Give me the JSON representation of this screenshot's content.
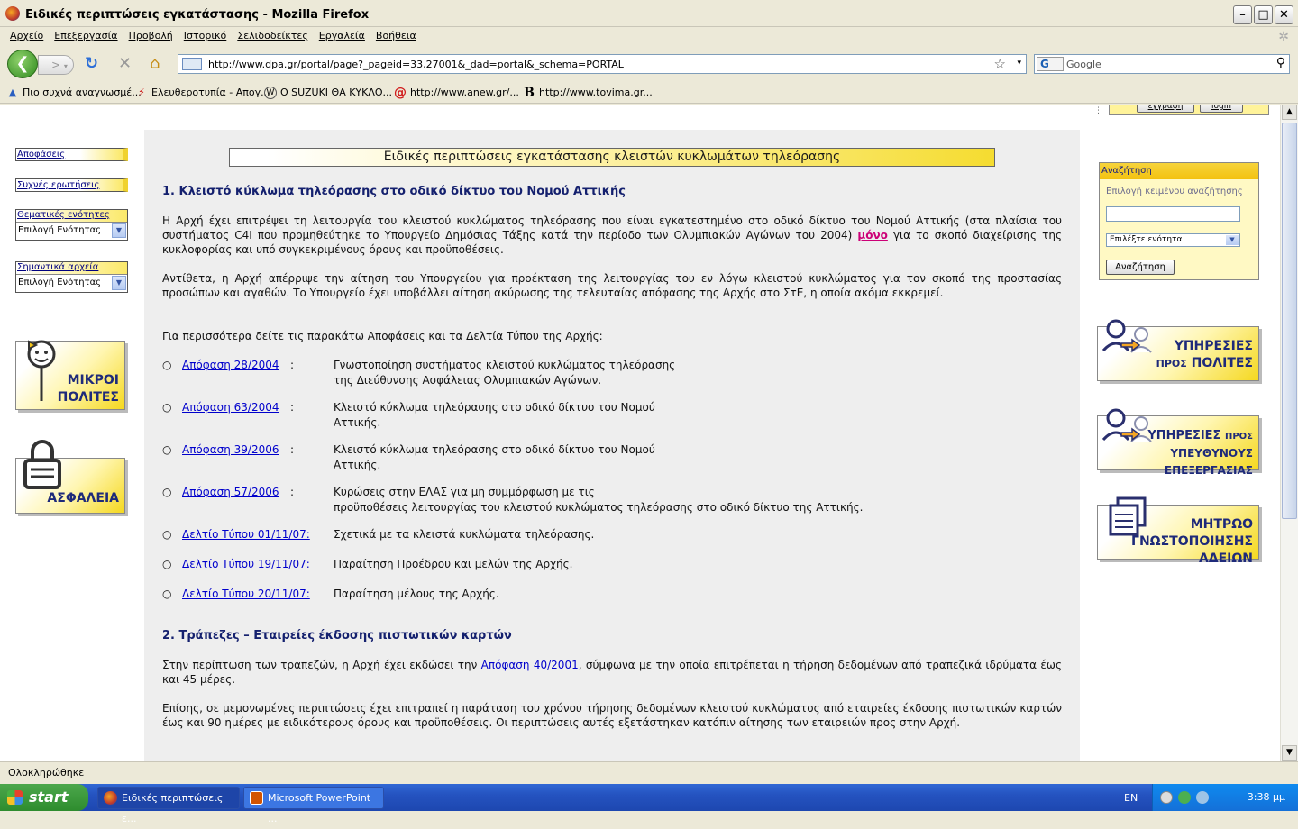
{
  "window": {
    "title": "Ειδικές περιπτώσεις εγκατάστασης - Mozilla Firefox"
  },
  "menu": [
    "Αρχείο",
    "Επεξεργασία",
    "Προβολή",
    "Ιστορικό",
    "Σελιδοδείκτες",
    "Εργαλεία",
    "Βοήθεια"
  ],
  "nav": {
    "url": "http://www.dpa.gr/portal/page?_pageid=33,27001&_dad=portal&_schema=PORTAL",
    "search_placeholder": "Google",
    "search_engine": "G"
  },
  "bookmarks": [
    {
      "icon": "person-icon",
      "label": "Πιο συχνά αναγνωσμέ..."
    },
    {
      "icon": "enet-icon",
      "label": "Ελευθεροτυπία - Απογ..."
    },
    {
      "icon": "wordpress-icon",
      "label": "Ο SUZUKI ΘΑ ΚΥΚΛΟ..."
    },
    {
      "icon": "at-icon",
      "label": "http://www.anew.gr/..."
    },
    {
      "icon": "b-icon",
      "label": "http://www.tovima.gr..."
    }
  ],
  "page": {
    "top_buttons": {
      "register": "εγγραφή",
      "login": "login"
    },
    "left": {
      "decisions": "Αποφάσεις",
      "faq": "Συχνές ερωτήσεις",
      "thematic": {
        "label": "Θεματικές ενότητες",
        "value": "Επιλογή Ενότητας"
      },
      "archives": {
        "label": "Σημαντικά αρχεία",
        "value": "Επιλογή Ενότητας"
      },
      "kids": [
        "ΜΙΚΡΟΙ",
        "ΠΟΛΙΤΕΣ"
      ],
      "security": "ΑΣΦΑΛΕΙΑ"
    },
    "title": "Ειδικές περιπτώσεις εγκατάστασης κλειστών κυκλωμάτων τηλεόρασης",
    "s1": {
      "heading": "1. Κλειστό κύκλωμα τηλεόρασης στο οδικό δίκτυο του Νομού Αττικής",
      "p1a": "Η Αρχή έχει επιτρέψει τη λειτουργία του κλειστού κυκλώματος τηλεόρασης που είναι εγκατεστημένο στο οδικό δίκτυο του Νομού Αττικής (στα πλαίσια του συστήματος C4I που προμηθεύτηκε το Υπουργείο Δημόσιας Τάξης κατά την περίοδο των Ολυμπιακών Αγώνων του 2004)",
      "p1link": "μόνο",
      "p1b": "για το σκοπό διαχείρισης της κυκλοφορίας και υπό συγκεκριμένους όρους και προϋποθέσεις.",
      "p2": "Αντίθετα, η Αρχή απέρριψε την αίτηση του Υπουργείου για προέκταση της λειτουργίας του εν λόγω κλειστού κυκλώματος για τον σκοπό της προστασίας προσώπων και αγαθών. Το Υπουργείο έχει υποβάλλει αίτηση ακύρωσης της τελευταίας απόφασης της Αρχής στο ΣτΕ, η οποία ακόμα εκκρεμεί.",
      "p3": "Για περισσότερα δείτε τις παρακάτω Αποφάσεις και τα Δελτία Τύπου της Αρχής:",
      "items": [
        {
          "link": "Απόφαση 28/2004",
          "sep": ":",
          "l1": "Γνωστοποίηση συστήματος κλειστού κυκλώματος τηλεόρασης",
          "l2": "της Διεύθυνσης Ασφάλειας Ολυμπιακών Αγώνων."
        },
        {
          "link": "Απόφαση 63/2004",
          "sep": ":",
          "l1": "Κλειστό κύκλωμα τηλεόρασης στο οδικό δίκτυο του Νομού",
          "l2": "Αττικής."
        },
        {
          "link": "Απόφαση 39/2006",
          "sep": ":",
          "l1": "Κλειστό κύκλωμα τηλεόρασης στο οδικό δίκτυο του Νομού",
          "l2": "Αττικής."
        },
        {
          "link": "Απόφαση 57/2006",
          "sep": ":",
          "l1": "Κυρώσεις στην ΕΛΑΣ για μη συμμόρφωση με τις",
          "l2": "προϋποθέσεις λειτουργίας του κλειστού κυκλώματος τηλεόρασης στο οδικό δίκτυο της Αττικής."
        },
        {
          "link": "Δελτίο Τύπου 01/11/07:",
          "sep": "",
          "l1": "Σχετικά με τα κλειστά κυκλώματα τηλεόρασης.",
          "l2": ""
        },
        {
          "link": "Δελτίο Τύπου 19/11/07:",
          "sep": "",
          "l1": "Παραίτηση Προέδρου και μελών της Αρχής.",
          "l2": ""
        },
        {
          "link": "Δελτίο Τύπου 20/11/07:",
          "sep": "",
          "l1": "Παραίτηση μέλους της Αρχής.",
          "l2": ""
        }
      ]
    },
    "s2": {
      "heading": "2. Τράπεζες – Εταιρείες έκδοσης πιστωτικών καρτών",
      "p1a": "Στην περίπτωση των τραπεζών, η Αρχή έχει εκδώσει την",
      "p1link": "Απόφαση 40/2001",
      "p1b": ", σύμφωνα με την οποία επιτρέπεται η τήρηση δεδομένων από τραπεζικά ιδρύματα έως και 45 μέρες.",
      "p2": "Επίσης, σε μεμονωμένες περιπτώσεις έχει επιτραπεί η παράταση του χρόνου τήρησης δεδομένων κλειστού κυκλώματος από εταιρείες έκδοσης πιστωτικών καρτών έως και 90 ημέρες με ειδικότερους όρους και προϋποθέσεις. Οι περιπτώσεις αυτές εξετάστηκαν κατόπιν αίτησης των εταιρειών προς στην Αρχή."
    },
    "search": {
      "header": "Αναζήτηση",
      "label": "Επιλογή κειμένου αναζήτησης",
      "select": "Επιλέξτε ενότητα",
      "button": "Αναζήτηση"
    },
    "promos": {
      "citizens": {
        "l1": "ΥΠΗΡΕΣΙΕΣ",
        "l2a": "ΠΡΟΣ",
        "l2b": "ΠΟΛΙΤΕΣ"
      },
      "controllers": {
        "l1a": "ΥΠΗΡΕΣΙΕΣ",
        "l1b": "ΠΡΟΣ",
        "l2": "ΥΠΕΥΘΥΝΟΥΣ ΕΠΕΞΕΡΓΑΣΙΑΣ"
      },
      "registry": {
        "l1": "ΜΗΤΡΩΟ",
        "l2": "ΓΝΩΣΤΟΠΟΙΗΣΗΣ ΑΔΕΙΩΝ"
      }
    }
  },
  "status": "Ολοκληρώθηκε",
  "taskbar": {
    "start": "start",
    "items": [
      {
        "label": "Ειδικές περιπτώσεις ε...",
        "icon": "firefox-icon"
      },
      {
        "label": "Microsoft PowerPoint ...",
        "icon": "powerpoint-icon"
      }
    ],
    "lang": "EN",
    "clock": "3:38 μμ"
  }
}
